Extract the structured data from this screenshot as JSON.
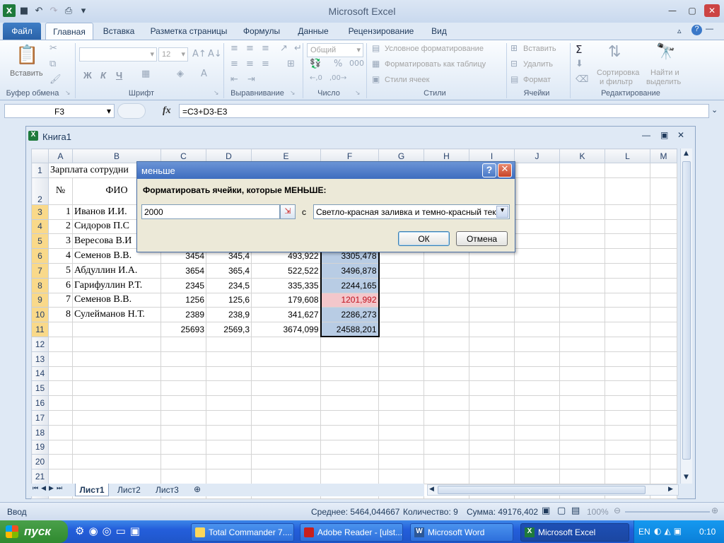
{
  "window": {
    "title": "Microsoft Excel",
    "min": "—",
    "max": "▢",
    "close": "✕"
  },
  "tabs": [
    "Файл",
    "Главная",
    "Вставка",
    "Разметка страницы",
    "Формулы",
    "Данные",
    "Рецензирование",
    "Вид"
  ],
  "ribbon": {
    "paste": "Вставить",
    "clipboard": "Буфер обмена",
    "font_size": "12",
    "bold": "Ж",
    "italic": "К",
    "underline": "Ч",
    "font": "Шрифт",
    "alignment": "Выравнивание",
    "number_format": "Общий",
    "number": "Число",
    "cond_format": "Условное форматирование",
    "format_table": "Форматировать как таблицу",
    "cell_styles": "Стили ячеек",
    "styles": "Стили",
    "insert": "Вставить",
    "delete": "Удалить",
    "format": "Формат",
    "cells": "Ячейки",
    "sort_filter_1": "Сортировка",
    "sort_filter_2": "и фильтр",
    "find_select_1": "Найти и",
    "find_select_2": "выделить",
    "editing": "Редактирование"
  },
  "formula_bar": {
    "name_box": "F3",
    "fx": "fx",
    "formula": "=C3+D3-E3"
  },
  "workbook": {
    "title": "Книга1"
  },
  "grid": {
    "columns": [
      "A",
      "B",
      "C",
      "D",
      "E",
      "F",
      "G",
      "H",
      "I",
      "J",
      "K",
      "L",
      "M"
    ],
    "title_cell": "Зарплата сотрудни",
    "header_a": "№",
    "header_b": "ФИО",
    "rows": [
      {
        "n": "3",
        "a": "1",
        "b": "Иванов И.И.",
        "c": "",
        "d": "",
        "e": "",
        "f": ""
      },
      {
        "n": "4",
        "a": "2",
        "b": "Сидоров П.С",
        "c": "",
        "d": "",
        "e": "",
        "f": ""
      },
      {
        "n": "5",
        "a": "3",
        "b": "Вересова В.И",
        "c": "",
        "d": "",
        "e": "",
        "f": ""
      },
      {
        "n": "6",
        "a": "4",
        "b": "Семенов В.В.",
        "c": "3454",
        "d": "345,4",
        "e": "493,922",
        "f": "3305,478"
      },
      {
        "n": "7",
        "a": "5",
        "b": "Абдуллин И.А.",
        "c": "3654",
        "d": "365,4",
        "e": "522,522",
        "f": "3496,878"
      },
      {
        "n": "8",
        "a": "6",
        "b": "Гарифуллин Р.Т.",
        "c": "2345",
        "d": "234,5",
        "e": "335,335",
        "f": "2244,165"
      },
      {
        "n": "9",
        "a": "7",
        "b": "Семенов В.В.",
        "c": "1256",
        "d": "125,6",
        "e": "179,608",
        "f": "1201,992"
      },
      {
        "n": "10",
        "a": "8",
        "b": "Сулейманов Н.Т.",
        "c": "2389",
        "d": "238,9",
        "e": "341,627",
        "f": "2286,273"
      }
    ],
    "total": {
      "c": "25693",
      "d": "2569,3",
      "e": "3674,099",
      "f": "24588,201"
    }
  },
  "sheets": [
    "Лист1",
    "Лист2",
    "Лист3"
  ],
  "status": {
    "mode": "Ввод",
    "average": "Среднее: 5464,044667",
    "count": "Количество: 9",
    "sum": "Сумма: 49176,402",
    "zoom": "100%"
  },
  "dialog": {
    "title": "меньше",
    "label": "Форматировать ячейки, которые МЕНЬШЕ:",
    "value": "2000",
    "with": "с",
    "format": "Светло-красная заливка и темно-красный текст",
    "ok": "ОК",
    "cancel": "Отмена",
    "help": "?",
    "close": "✕"
  },
  "taskbar": {
    "start": "пуск",
    "items": [
      "Total Commander 7....",
      "Adobe Reader - [ulst...",
      "Microsoft Word",
      "Microsoft Excel"
    ],
    "lang": "EN",
    "time": "0:10"
  }
}
